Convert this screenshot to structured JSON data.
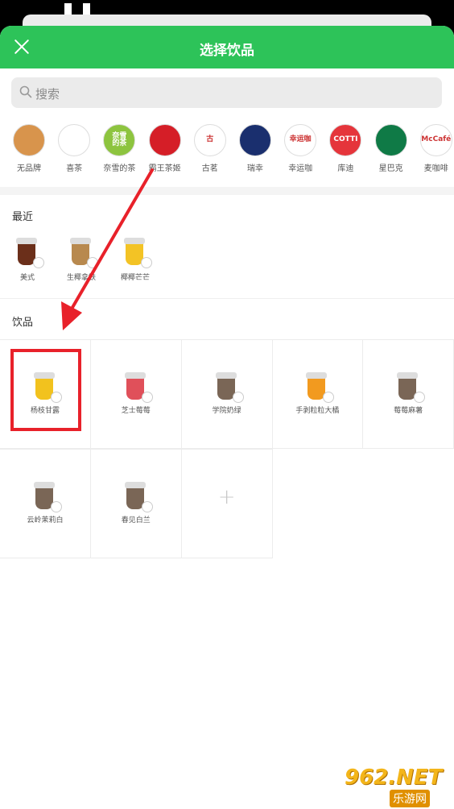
{
  "header": {
    "title": "选择饮品"
  },
  "search": {
    "placeholder": "搜索"
  },
  "brands": [
    {
      "label": "无品牌",
      "logo_text": "",
      "color": "#d8944c"
    },
    {
      "label": "喜茶",
      "logo_text": "",
      "color": "#ffffff"
    },
    {
      "label": "奈雪的茶",
      "logo_text": "奈雪\n的茶",
      "color": "#8dc43f"
    },
    {
      "label": "霸王茶姬",
      "logo_text": "",
      "color": "#d51e27"
    },
    {
      "label": "古茗",
      "logo_text": "古",
      "color": "#ffffff"
    },
    {
      "label": "瑞幸",
      "logo_text": "",
      "color": "#1a2f6e"
    },
    {
      "label": "幸运咖",
      "logo_text": "幸运咖",
      "color": "#ffffff"
    },
    {
      "label": "库迪",
      "logo_text": "COTTI",
      "color": "#e5353b"
    },
    {
      "label": "星巴克",
      "logo_text": "",
      "color": "#0f7a46"
    },
    {
      "label": "麦咖啡",
      "logo_text": "McCafé",
      "color": "#ffffff"
    }
  ],
  "recent": {
    "title": "最近",
    "items": [
      {
        "label": "美式",
        "color": "#6b2f1a"
      },
      {
        "label": "生椰拿铁",
        "color": "#b8894e"
      },
      {
        "label": "椰椰芒芒",
        "color": "#f3c325"
      }
    ]
  },
  "drinks": {
    "title": "饮品",
    "items": [
      {
        "label": "杨枝甘露",
        "color": "#f2c21e"
      },
      {
        "label": "芝士莓莓",
        "color": "#e0505a"
      },
      {
        "label": "学院奶绿",
        "color": "#7a6656"
      },
      {
        "label": "手剥粒粒大橘",
        "color": "#f29a1f"
      },
      {
        "label": "莓莓麻薯",
        "color": "#7a6656"
      },
      {
        "label": "云岭茉莉白",
        "color": "#7a6656"
      },
      {
        "label": "春见白兰",
        "color": "#7a6656"
      }
    ]
  },
  "watermark": {
    "main": "962.NET",
    "sub": "乐游网"
  },
  "colors": {
    "accent": "#2dc359",
    "annotation": "#e8212a"
  }
}
